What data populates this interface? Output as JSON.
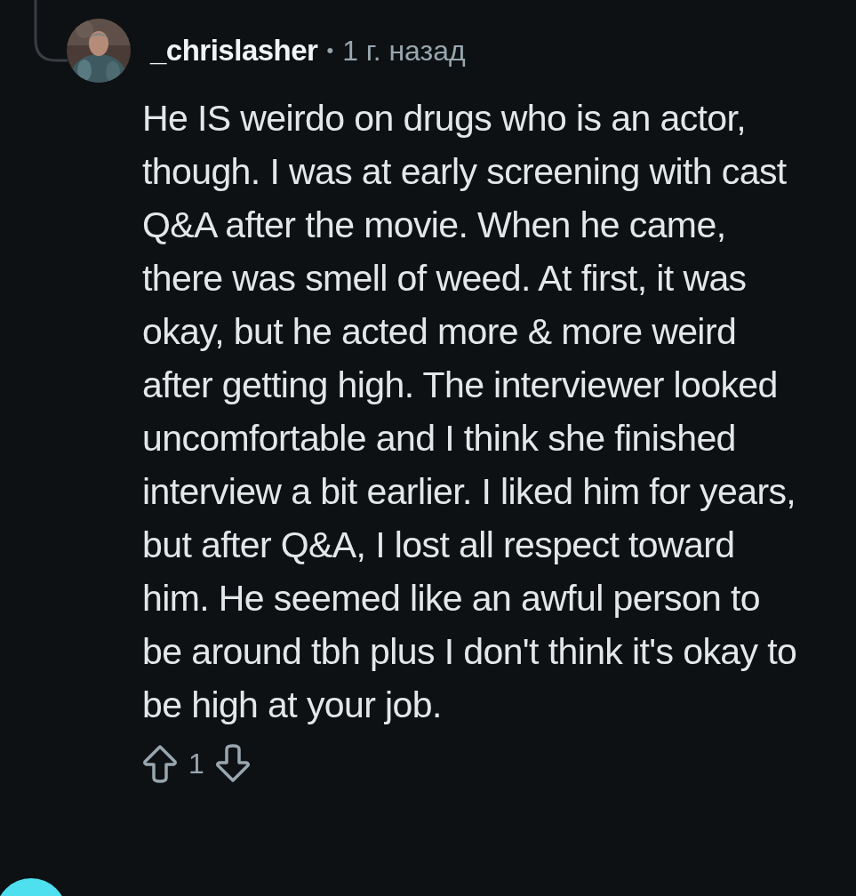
{
  "comment": {
    "author": "_chrislasher",
    "separator": "•",
    "time": "1 г. назад",
    "body": "He IS weirdo on drugs who is an actor, though. I was at early screening with cast Q&A after the movie. When he came, there was smell of weed. At first, it was okay, but he acted more & more weird after getting high. The interviewer looked uncomfortable and I think she finished interview a bit earlier. I liked him for years, but after Q&A, I lost all respect toward him. He seemed like an awful person to be around tbh plus I don't think it's okay to be high at your job.",
    "votes": "1"
  }
}
